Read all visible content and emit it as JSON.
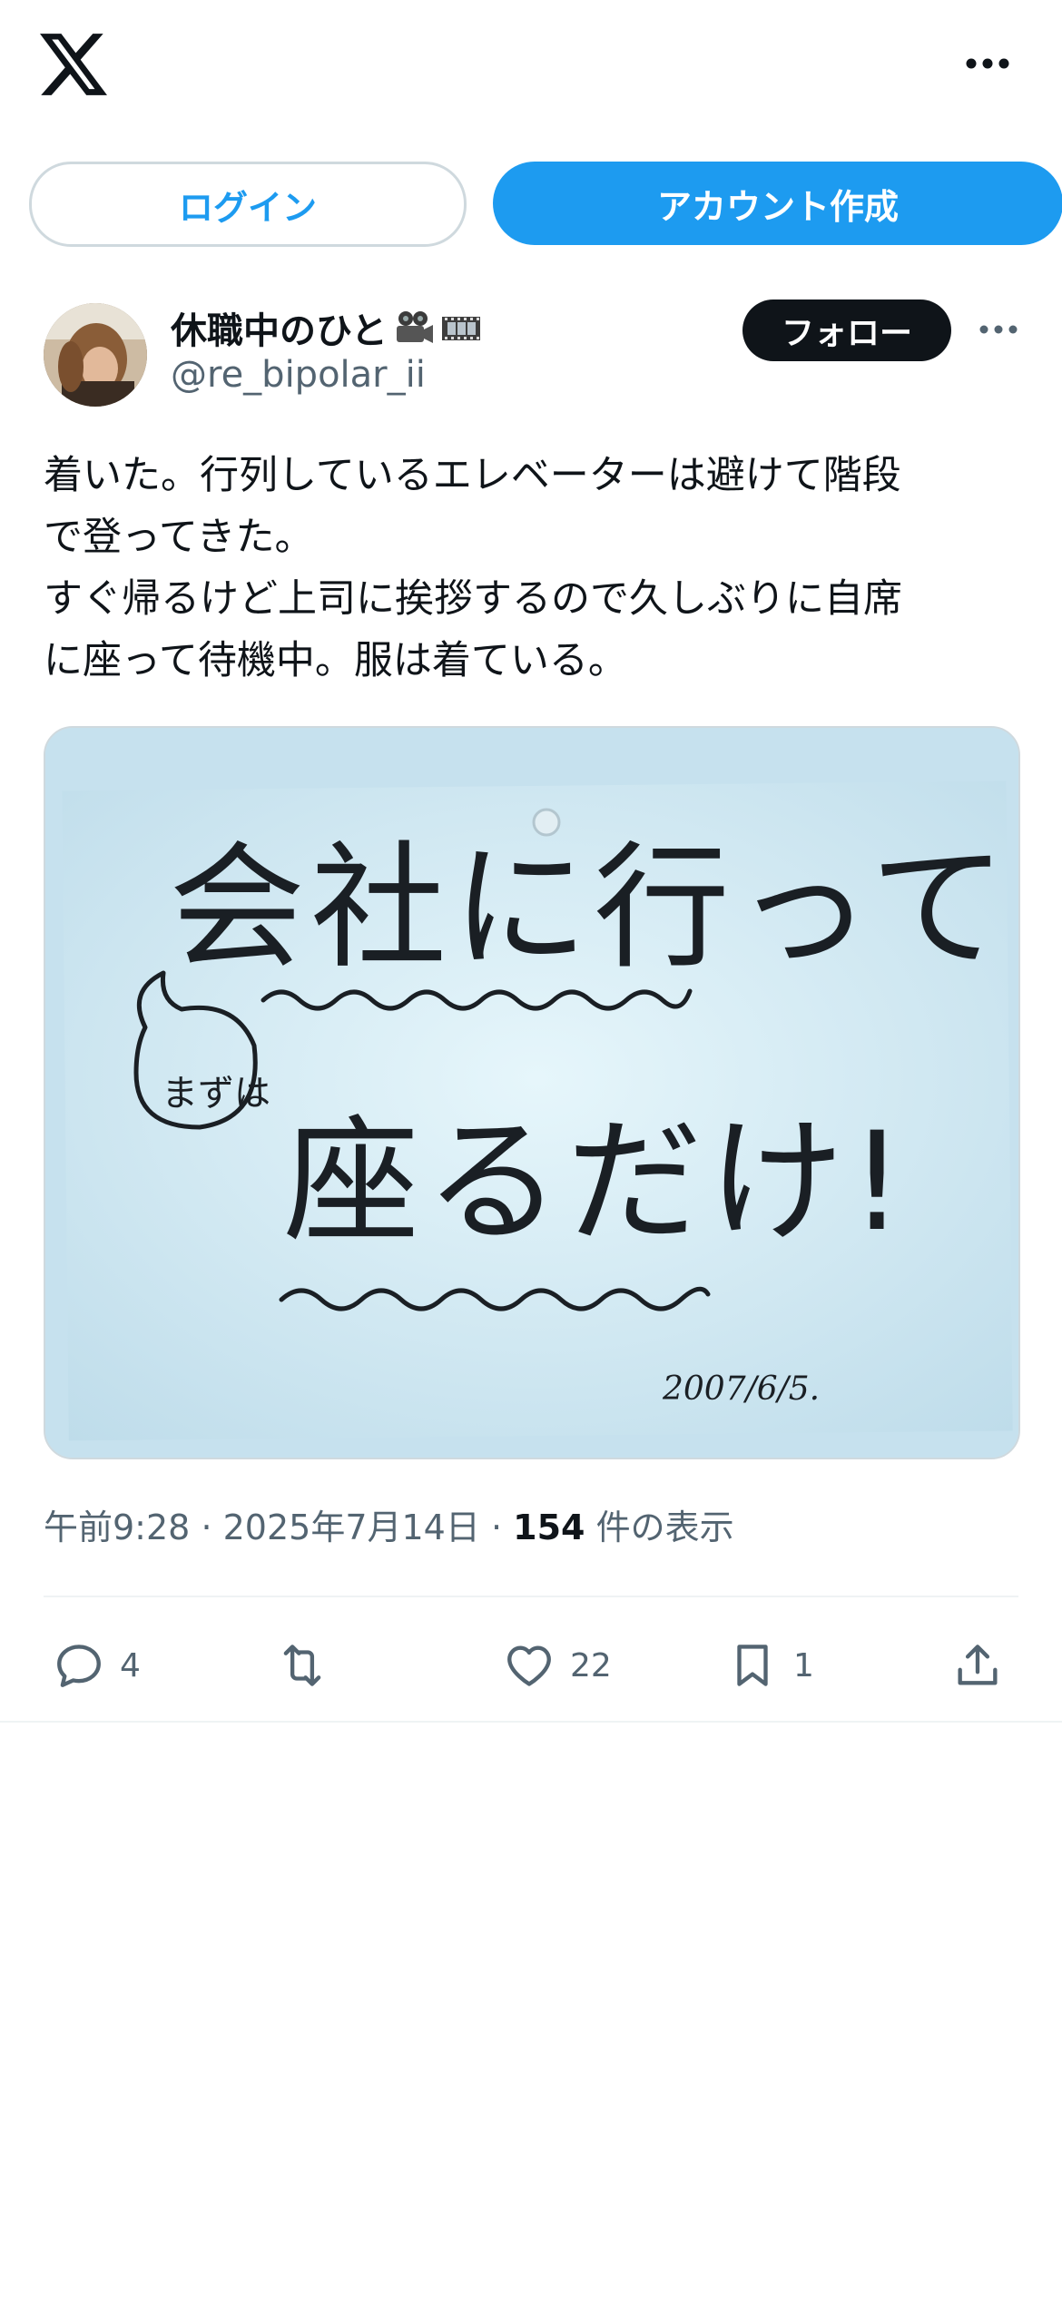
{
  "header": {
    "logo_icon": "x-logo-icon",
    "more_icon": "more-horizontal-icon"
  },
  "auth": {
    "login_label": "ログイン",
    "signup_label": "アカウント作成"
  },
  "tweet": {
    "author": {
      "display_name": "休職中のひと",
      "handle": "@re_bipolar_ii",
      "name_emojis": [
        "movie-camera-icon",
        "film-frames-icon"
      ]
    },
    "follow_label": "フォロー",
    "text": "着いた。行列しているエレベーターは避けて階段\nで登ってきた。\nすぐ帰るけど上司に挨拶するので久しぶりに自席\nに座って待機中。服は着ている。",
    "media": {
      "note_line1": "会社に行って",
      "note_bubble": "まずは",
      "note_line2": "座るだけ!",
      "note_date": "2007/6/5."
    },
    "meta": {
      "time": "午前9:28",
      "separator": "·",
      "date": "2025年7月14日",
      "views_count": "154",
      "views_label": "件の表示"
    },
    "actions": {
      "reply_count": "4",
      "retweet_count": "",
      "like_count": "22",
      "bookmark_count": "1"
    }
  },
  "colors": {
    "accent": "#1d9bf0",
    "text_primary": "#0f1419",
    "text_secondary": "#536471",
    "border": "#cfd9de"
  }
}
